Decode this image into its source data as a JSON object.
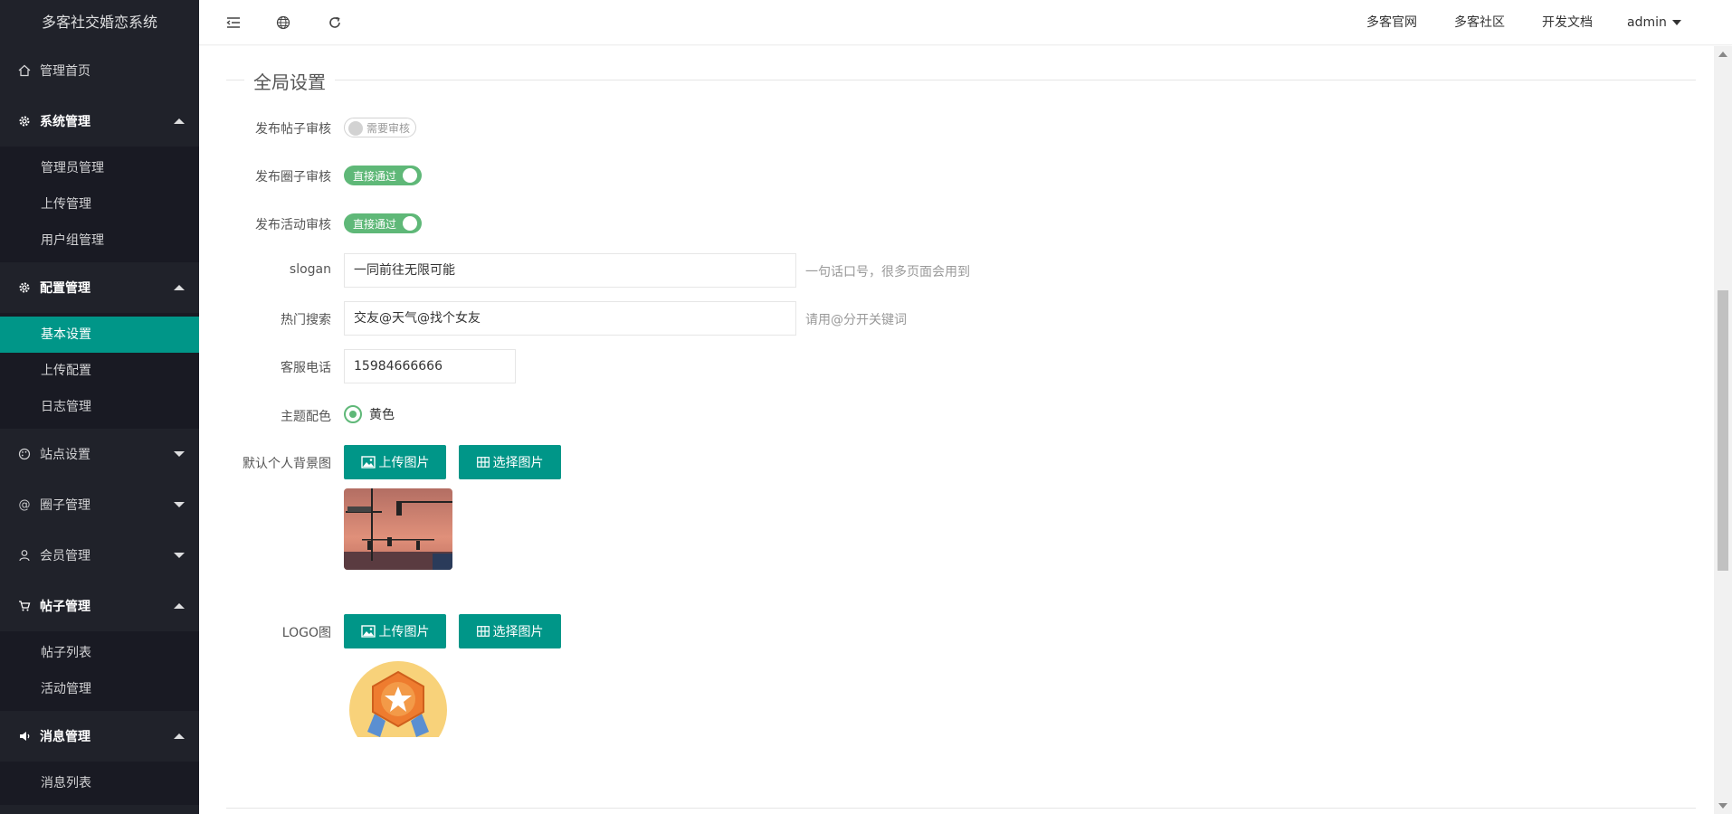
{
  "app": {
    "title": "多客社交婚恋系统"
  },
  "sidebar": {
    "home": "管理首页",
    "system": {
      "label": "系统管理",
      "items": [
        "管理员管理",
        "上传管理",
        "用户组管理"
      ]
    },
    "config": {
      "label": "配置管理",
      "items": [
        "基本设置",
        "上传配置",
        "日志管理"
      ]
    },
    "site": "站点设置",
    "circle": "圈子管理",
    "member": "会员管理",
    "post": {
      "label": "帖子管理",
      "items": [
        "帖子列表",
        "活动管理"
      ]
    },
    "message": {
      "label": "消息管理",
      "items": [
        "消息列表"
      ]
    }
  },
  "header": {
    "links": [
      "多客官网",
      "多客社区",
      "开发文档"
    ],
    "user": "admin"
  },
  "form": {
    "section_title": "全局设置",
    "post_review": {
      "label": "发布帖子审核",
      "switch_text": "需要审核",
      "on": false
    },
    "circle_review": {
      "label": "发布圈子审核",
      "switch_text": "直接通过",
      "on": true
    },
    "activity_review": {
      "label": "发布活动审核",
      "switch_text": "直接通过",
      "on": true
    },
    "slogan": {
      "label": "slogan",
      "value": "一同前往无限可能",
      "hint": "一句话口号，很多页面会用到"
    },
    "hot_search": {
      "label": "热门搜索",
      "value": "交友@天气@找个女友",
      "hint": "请用@分开关键词"
    },
    "phone": {
      "label": "客服电话",
      "value": "15984666666"
    },
    "theme": {
      "label": "主题配色",
      "option": "黄色"
    },
    "bg_image": {
      "label": "默认个人背景图",
      "upload": "上传图片",
      "choose": "选择图片"
    },
    "logo": {
      "label": "LOGO图",
      "upload": "上传图片",
      "choose": "选择图片"
    }
  },
  "colors": {
    "accent": "#009688",
    "switch_on": "#5fb878",
    "sidebar": "#20222a"
  }
}
